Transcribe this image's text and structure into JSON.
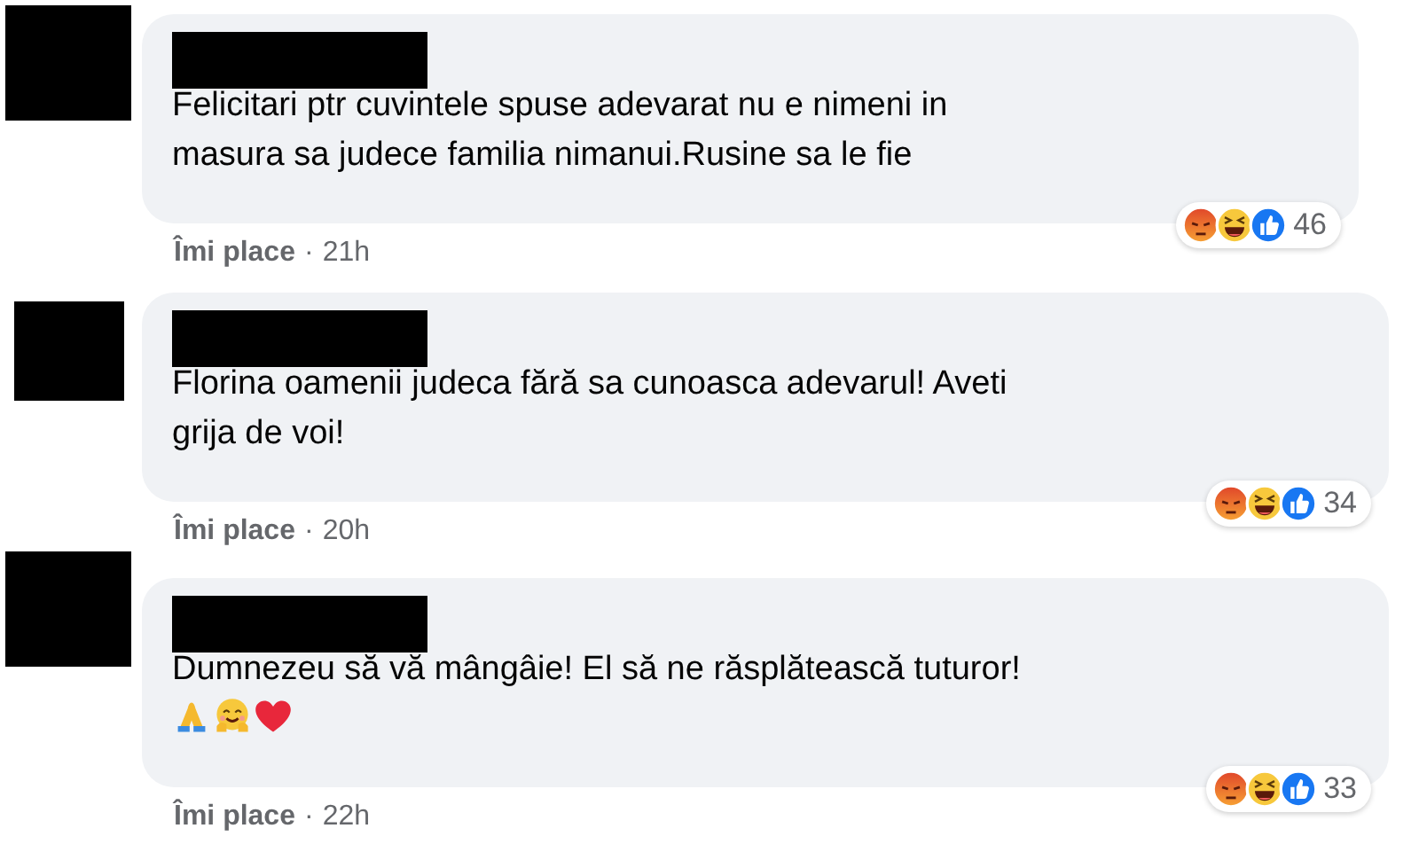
{
  "comments": [
    {
      "text": "Felicitari ptr cuvintele spuse adevarat nu e nimeni in masura sa judece familia nimanui.Rusine sa le fie",
      "like_label": "Îmi place",
      "separator": "·",
      "time": "21h",
      "reactions": [
        {
          "kind": "angry"
        },
        {
          "kind": "haha"
        },
        {
          "kind": "like"
        }
      ],
      "reaction_count": "46"
    },
    {
      "text": "Florina oamenii judeca fără sa cunoasca adevarul! Aveti grija de voi!",
      "like_label": "Îmi place",
      "separator": "·",
      "time": "20h",
      "reactions": [
        {
          "kind": "angry"
        },
        {
          "kind": "haha"
        },
        {
          "kind": "like"
        }
      ],
      "reaction_count": "34"
    },
    {
      "text": "Dumnezeu să vă mângâie! El să ne răsplătească tuturor!",
      "emojis": [
        {
          "kind": "pray"
        },
        {
          "kind": "hug"
        },
        {
          "kind": "heart"
        }
      ],
      "like_label": "Îmi place",
      "separator": "·",
      "time": "22h",
      "reactions": [
        {
          "kind": "angry"
        },
        {
          "kind": "haha"
        },
        {
          "kind": "like"
        }
      ],
      "reaction_count": "33"
    }
  ]
}
